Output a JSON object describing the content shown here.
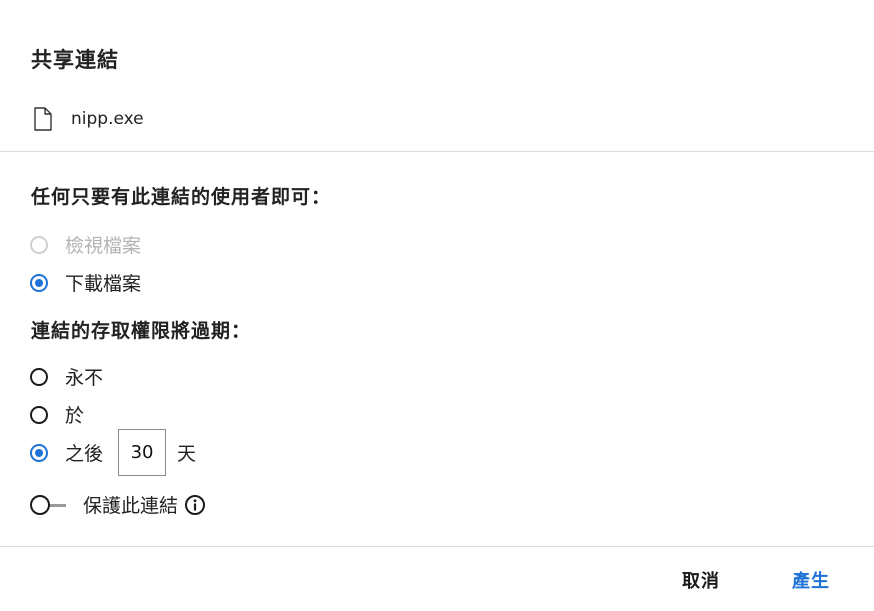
{
  "dialog": {
    "title": "共享連結",
    "file_name": "nipp.exe"
  },
  "permissions": {
    "heading": "任何只要有此連結的使用者即可：",
    "options": [
      {
        "label": "檢視檔案",
        "checked": false,
        "disabled": true
      },
      {
        "label": "下載檔案",
        "checked": true,
        "disabled": false
      }
    ]
  },
  "expiration": {
    "heading": "連結的存取權限將過期：",
    "options": [
      {
        "label": "永不",
        "checked": false
      },
      {
        "label": "於",
        "checked": false
      },
      {
        "label": "之後",
        "checked": true
      }
    ],
    "days_value": "30",
    "days_unit": "天"
  },
  "protect": {
    "label": "保護此連結",
    "enabled": false
  },
  "footer": {
    "cancel_label": "取消",
    "generate_label": "產生"
  },
  "colors": {
    "accent": "#1f73d6",
    "divider": "#dcdcdc",
    "disabled_text": "#b4b4b4"
  },
  "icons": {
    "file": "file-icon",
    "info": "info-icon"
  }
}
